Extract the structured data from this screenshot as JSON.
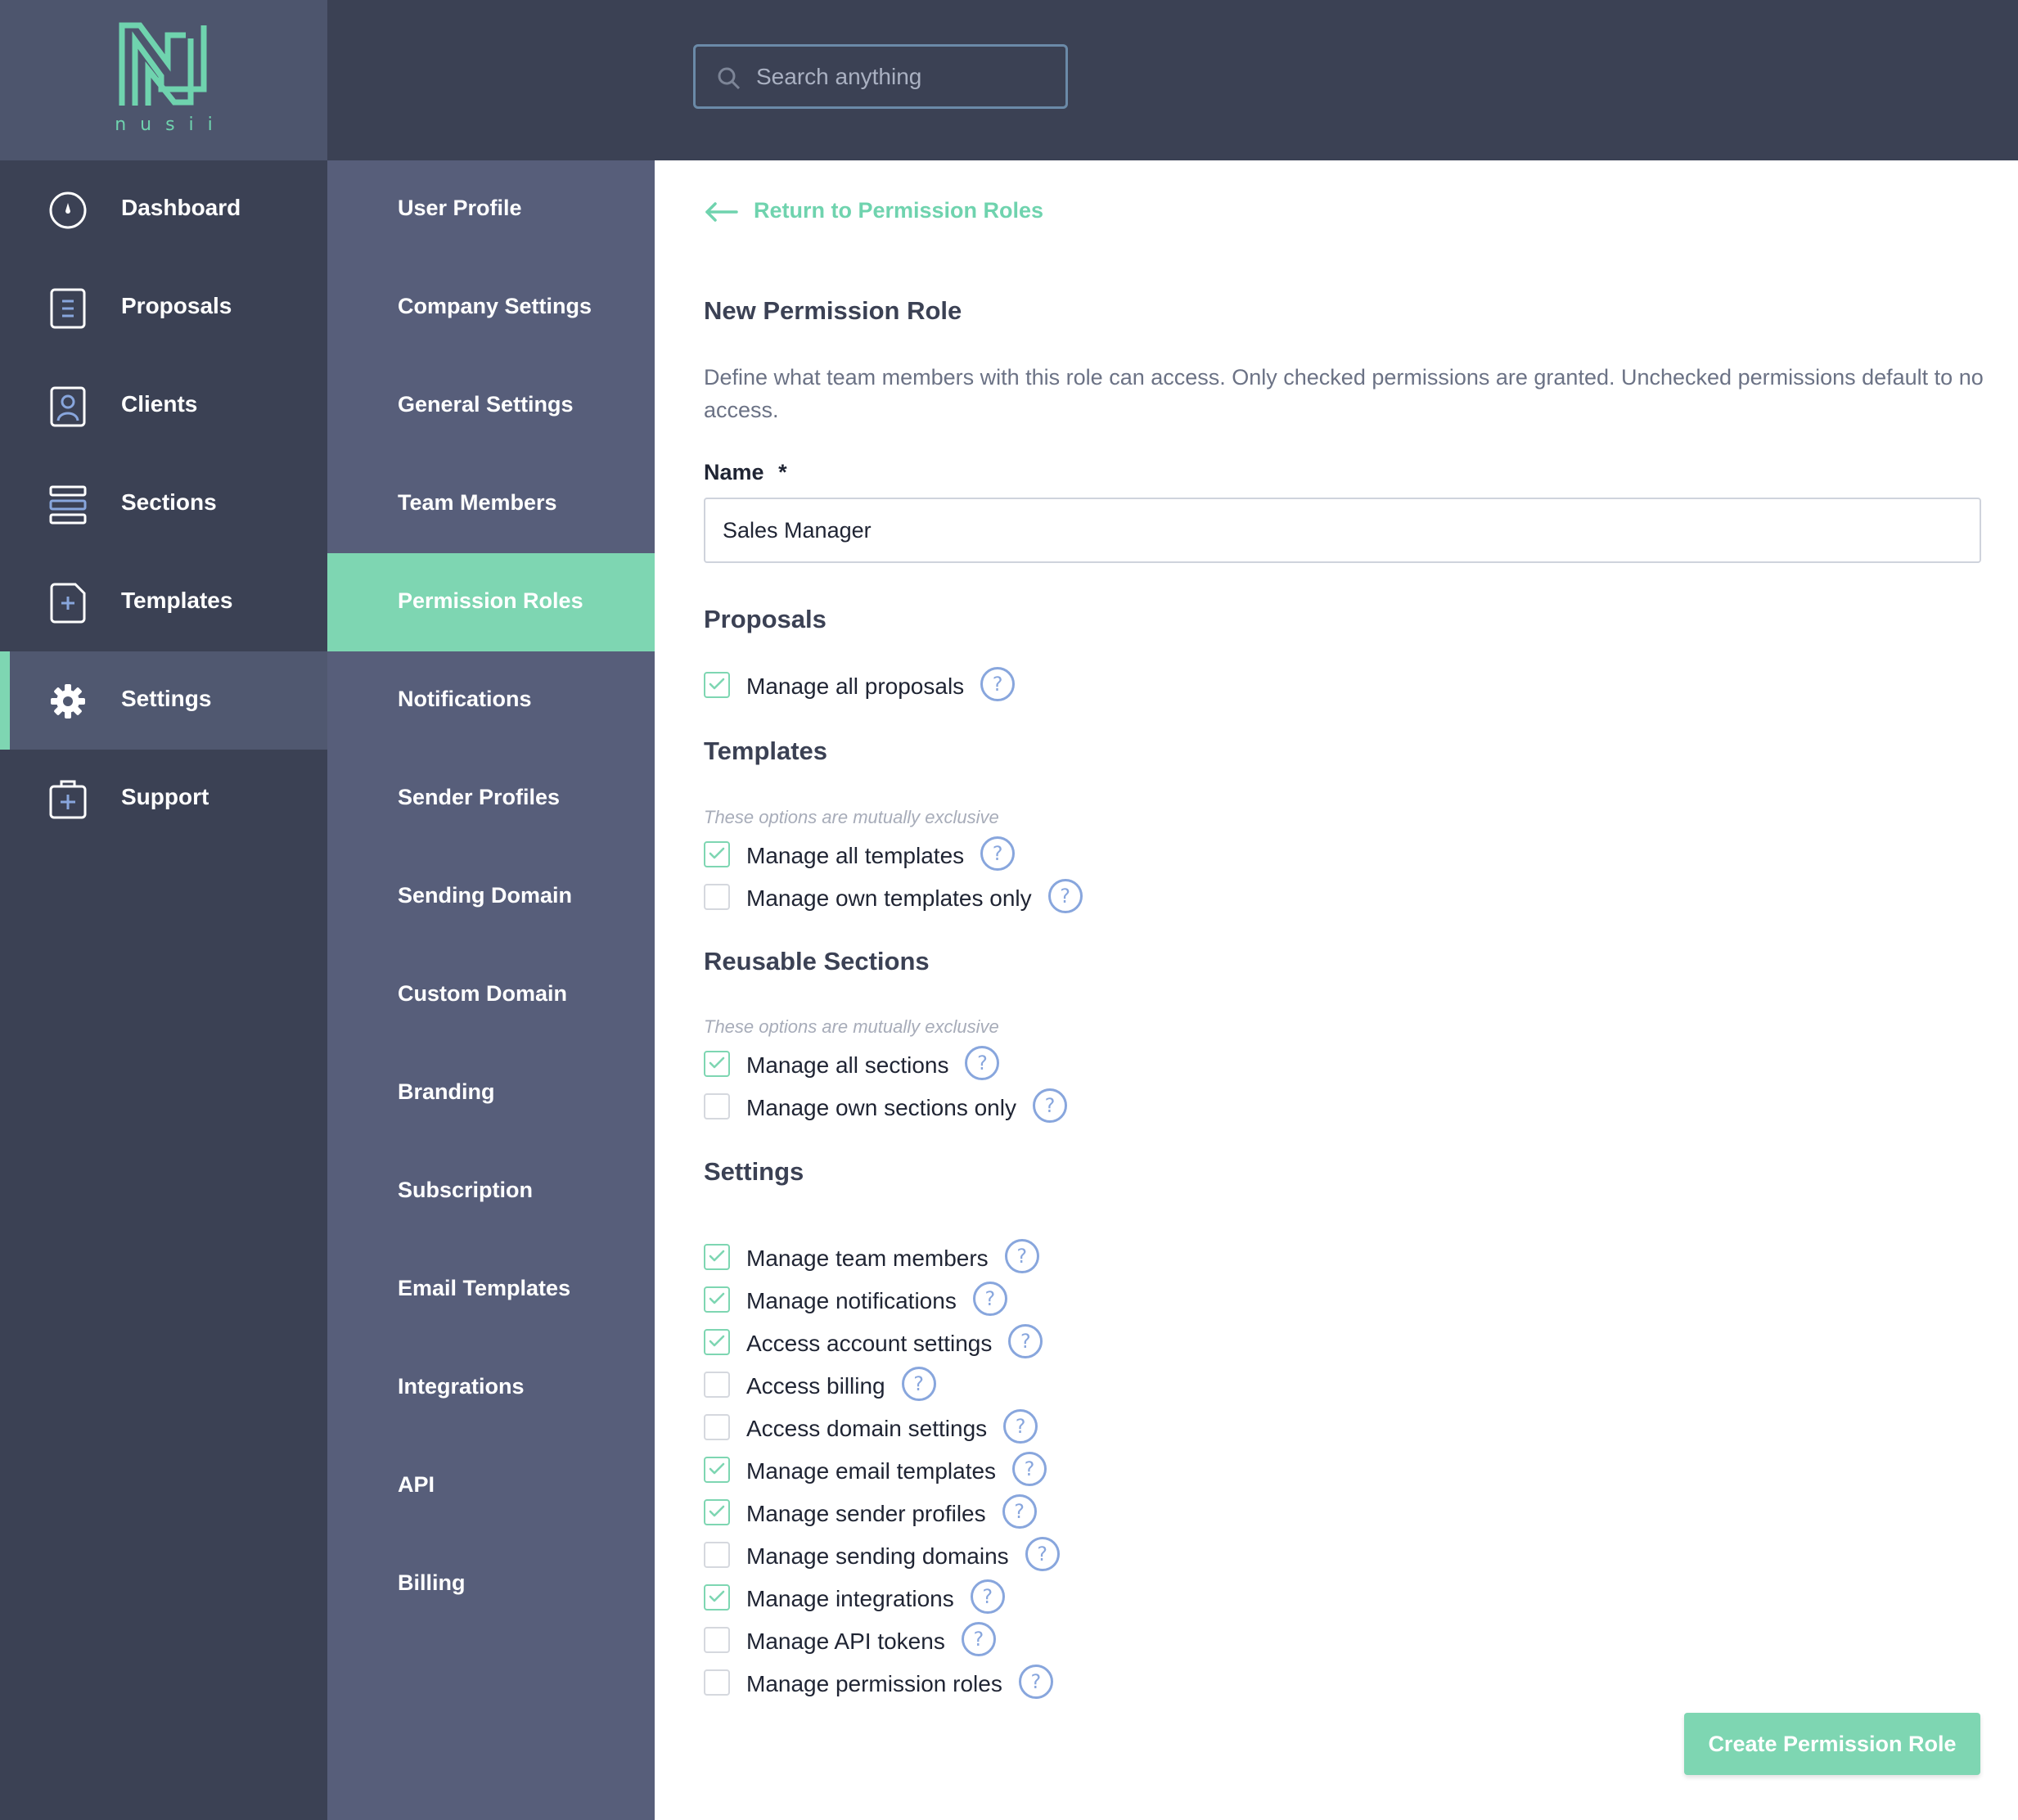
{
  "brand": {
    "name": "nusii",
    "color": "#6fd3ae"
  },
  "search": {
    "placeholder": "Search anything"
  },
  "sidebar": {
    "items": [
      {
        "label": "Dashboard",
        "icon": "dashboard-icon",
        "active": false
      },
      {
        "label": "Proposals",
        "icon": "proposals-icon",
        "active": false
      },
      {
        "label": "Clients",
        "icon": "clients-icon",
        "active": false
      },
      {
        "label": "Sections",
        "icon": "sections-icon",
        "active": false
      },
      {
        "label": "Templates",
        "icon": "templates-icon",
        "active": false
      },
      {
        "label": "Settings",
        "icon": "gear-icon",
        "active": true
      },
      {
        "label": "Support",
        "icon": "support-icon",
        "active": false
      }
    ]
  },
  "settings_menu": {
    "items": [
      {
        "label": "User Profile",
        "active": false
      },
      {
        "label": "Company Settings",
        "active": false
      },
      {
        "label": "General Settings",
        "active": false
      },
      {
        "label": "Team Members",
        "active": false
      },
      {
        "label": "Permission Roles",
        "active": true
      },
      {
        "label": "Notifications",
        "active": false
      },
      {
        "label": "Sender Profiles",
        "active": false
      },
      {
        "label": "Sending Domain",
        "active": false
      },
      {
        "label": "Custom Domain",
        "active": false
      },
      {
        "label": "Branding",
        "active": false
      },
      {
        "label": "Subscription",
        "active": false
      },
      {
        "label": "Email Templates",
        "active": false
      },
      {
        "label": "Integrations",
        "active": false
      },
      {
        "label": "API",
        "active": false
      },
      {
        "label": "Billing",
        "active": false
      }
    ]
  },
  "main": {
    "back_link": "Return to Permission Roles",
    "title": "New Permission Role",
    "description": "Define what team members with this role can access. Only checked permissions are granted. Unchecked permissions default to no access.",
    "name_label": "Name",
    "required_marker": "*",
    "name_value": "Sales Manager",
    "help_glyph": "?",
    "groups": {
      "proposals": {
        "title": "Proposals",
        "permissions": [
          {
            "label": "Manage all proposals",
            "checked": true
          }
        ]
      },
      "templates": {
        "title": "Templates",
        "hint": "These options are mutually exclusive",
        "permissions": [
          {
            "label": "Manage all templates",
            "checked": true
          },
          {
            "label": "Manage own templates only",
            "checked": false
          }
        ]
      },
      "sections": {
        "title": "Reusable Sections",
        "hint": "These options are mutually exclusive",
        "permissions": [
          {
            "label": "Manage all sections",
            "checked": true
          },
          {
            "label": "Manage own sections only",
            "checked": false
          }
        ]
      },
      "settings": {
        "title": "Settings",
        "permissions": [
          {
            "label": "Manage team members",
            "checked": true
          },
          {
            "label": "Manage notifications",
            "checked": true
          },
          {
            "label": "Access account settings",
            "checked": true
          },
          {
            "label": "Access billing",
            "checked": false
          },
          {
            "label": "Access domain settings",
            "checked": false
          },
          {
            "label": "Manage email templates",
            "checked": true
          },
          {
            "label": "Manage sender profiles",
            "checked": true
          },
          {
            "label": "Manage sending domains",
            "checked": false
          },
          {
            "label": "Manage integrations",
            "checked": true
          },
          {
            "label": "Manage API tokens",
            "checked": false
          },
          {
            "label": "Manage permission roles",
            "checked": false
          }
        ]
      }
    },
    "submit_label": "Create Permission Role"
  },
  "colors": {
    "accent": "#7ed6b2",
    "sidebar_bg": "#3b4154",
    "submenu_bg": "#575e7a",
    "help_icon": "#88a6dd"
  }
}
